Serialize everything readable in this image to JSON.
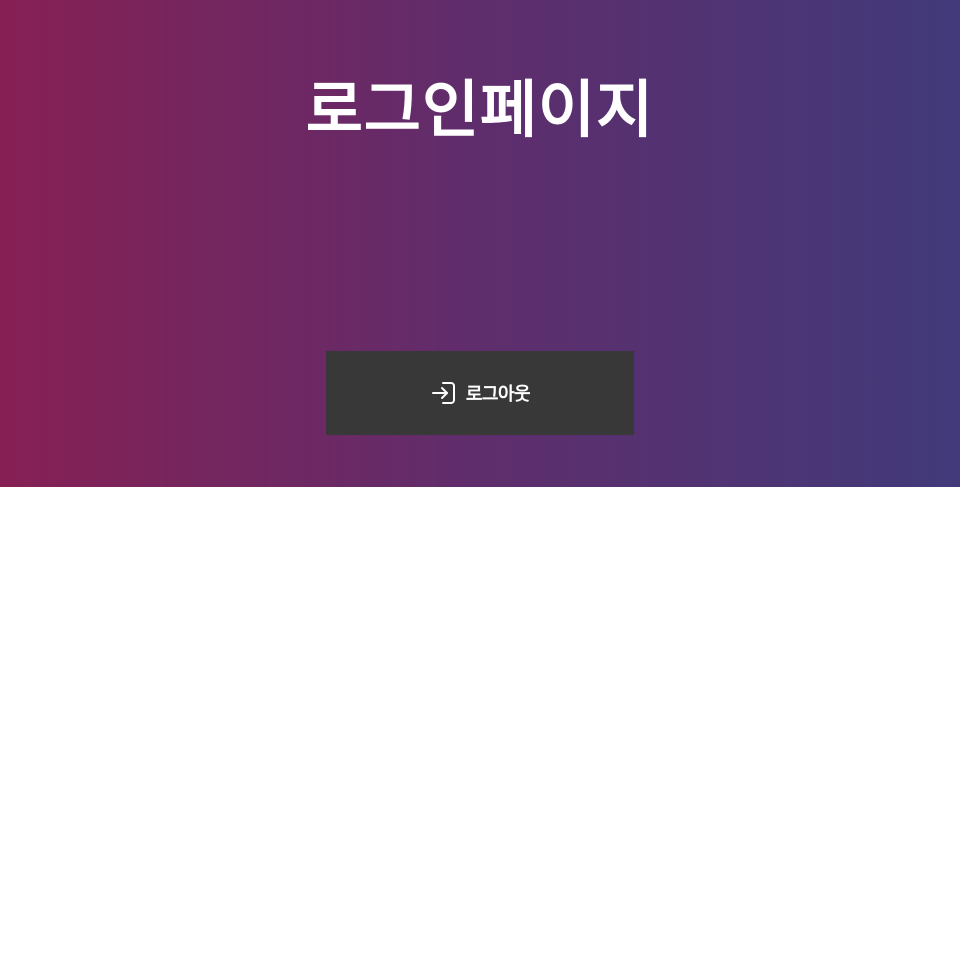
{
  "header": {
    "title": "로그인페이지",
    "gradient_start": "#862054",
    "gradient_end": "#413a7a"
  },
  "logout_button": {
    "label": "로그아웃",
    "icon": "sign-in-arrow-icon",
    "background": "#383838"
  }
}
